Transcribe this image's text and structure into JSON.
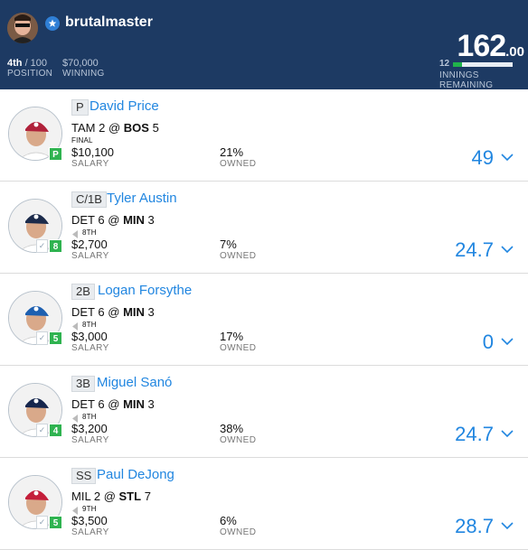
{
  "header": {
    "username": "brutalmaster",
    "position_value": "4th",
    "position_total": "/ 100",
    "position_label": "POSITION",
    "winning_value": "$70,000",
    "winning_label": "WINNING",
    "score_whole": "162",
    "score_decimal": ".00",
    "innings_count": "12",
    "innings_label": "INNINGS REMAINING",
    "innings_progress_fraction": 0.15,
    "colors": {
      "header_bg": "#1d3a63",
      "accent_blue": "#2186e0",
      "status_green": "#2fb350"
    }
  },
  "players": [
    {
      "position": "P",
      "name": "David Price",
      "away_team": "TAM",
      "away_score": "2",
      "at": "@",
      "home_team": "BOS",
      "home_score": "5",
      "bold_team": "home",
      "inning": "FINAL",
      "salary": "$10,100",
      "salary_label": "SALARY",
      "owned": "21%",
      "owned_label": "OWNED",
      "points": "49",
      "badge": "P",
      "cap_color": "#b0213a",
      "jersey_color": "#ffffff"
    },
    {
      "position": "C/1B",
      "name": "Tyler Austin",
      "away_team": "DET",
      "away_score": "6",
      "at": "@",
      "home_team": "MIN",
      "home_score": "3",
      "bold_team": "home",
      "inning": "8TH",
      "salary": "$2,700",
      "salary_label": "SALARY",
      "owned": "7%",
      "owned_label": "OWNED",
      "points": "24.7",
      "badge": "8",
      "cap_color": "#1b2a4a",
      "jersey_color": "#ffffff"
    },
    {
      "position": "2B",
      "name": "Logan Forsythe",
      "away_team": "DET",
      "away_score": "6",
      "at": "@",
      "home_team": "MIN",
      "home_score": "3",
      "bold_team": "home",
      "inning": "8TH",
      "salary": "$3,000",
      "salary_label": "SALARY",
      "owned": "17%",
      "owned_label": "OWNED",
      "points": "0",
      "badge": "5",
      "cap_color": "#1d5fb0",
      "jersey_color": "#ffffff"
    },
    {
      "position": "3B",
      "name": "Miguel Sanó",
      "away_team": "DET",
      "away_score": "6",
      "at": "@",
      "home_team": "MIN",
      "home_score": "3",
      "bold_team": "home",
      "inning": "8TH",
      "salary": "$3,200",
      "salary_label": "SALARY",
      "owned": "38%",
      "owned_label": "OWNED",
      "points": "24.7",
      "badge": "4",
      "cap_color": "#15264d",
      "jersey_color": "#ffffff"
    },
    {
      "position": "SS",
      "name": "Paul DeJong",
      "away_team": "MIL",
      "away_score": "2",
      "at": "@",
      "home_team": "STL",
      "home_score": "7",
      "bold_team": "home",
      "inning": "9TH",
      "salary": "$3,500",
      "salary_label": "SALARY",
      "owned": "6%",
      "owned_label": "OWNED",
      "points": "28.7",
      "badge": "5",
      "cap_color": "#c41e3a",
      "jersey_color": "#ffffff"
    }
  ]
}
